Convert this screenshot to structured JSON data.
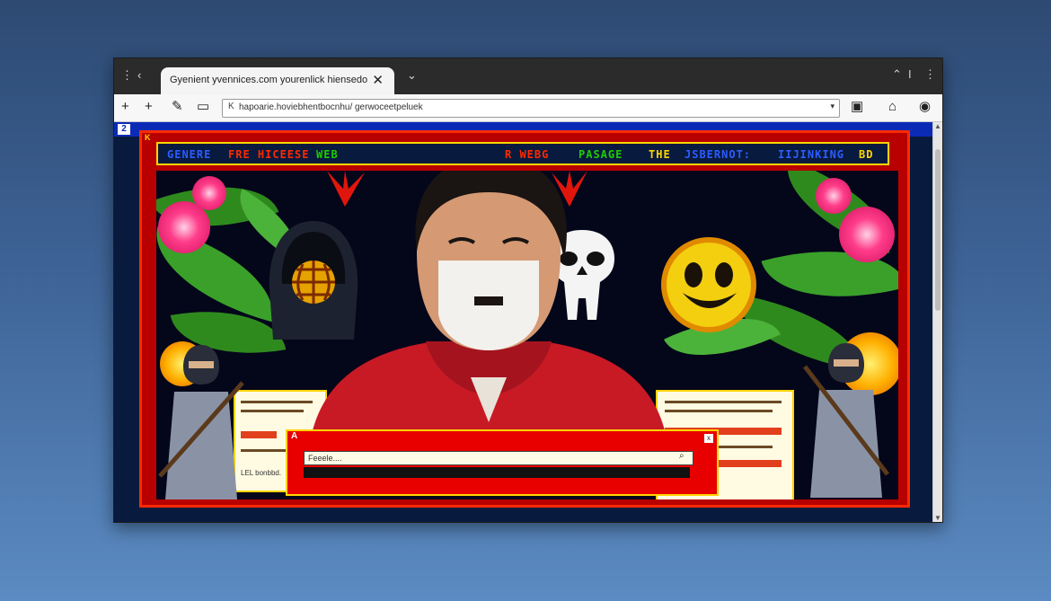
{
  "browser": {
    "tab_title": "Gyenient yvennices.com yourenlick hiensedo",
    "address_url": "hapoarie.hoviebhentbocnhu/ gerwoceetpeluek",
    "back_icon": "back-arrow-icon",
    "forward_icon": "forward-arrow-icon",
    "close_icon": "close-icon",
    "new_tab_icon": "plus-icon"
  },
  "page": {
    "badge": "2",
    "frame_marker": "K",
    "banner_text": [
      {
        "text": "GENERE",
        "color": "#2d5cff"
      },
      {
        "text": "FRE HICEESE",
        "color": "#ff2a00"
      },
      {
        "text": "WEB",
        "color": "#1fcc00"
      },
      {
        "text": "R WEBG",
        "color": "#ff2a00"
      },
      {
        "text": "PASAGE",
        "color": "#1fcc00"
      },
      {
        "text": "THE",
        "color": "#ffd400"
      },
      {
        "text": "JSBERNOT:",
        "color": "#2d5cff"
      },
      {
        "text": "IIJINKING",
        "color": "#2d5cff"
      },
      {
        "text": "BD",
        "color": "#ffd400"
      }
    ],
    "side_text": "LEL bonbbd."
  },
  "search_dialog": {
    "marker": "A",
    "close_label": "x",
    "placeholder": "Feeele...."
  },
  "colors": {
    "accent_red": "#e80000",
    "frame_yellow": "#ffd400",
    "hoodie": "#c81a25",
    "skin": "#d59a74"
  }
}
